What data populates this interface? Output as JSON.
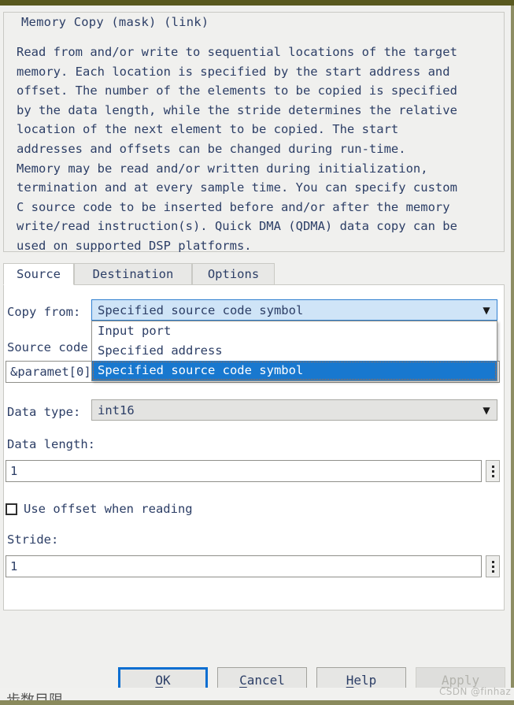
{
  "window": {
    "accent_border_color": "#59591f",
    "dialog_background": "#f0f0ee",
    "text_color": "#2c3e66"
  },
  "description_panel": {
    "title": "Memory Copy (mask) (link)",
    "body": "Read from and/or write to sequential locations of the target\nmemory. Each location is specified by the start address and\noffset. The number of the elements to be copied is specified\nby the data length, while the stride determines the relative\nlocation of the next element to be copied. The start\naddresses and offsets can be changed during run-time.\nMemory may be read and/or written during initialization,\ntermination and at every sample time. You can specify custom\nC source code to be inserted before and/or after the memory\nwrite/read instruction(s). Quick DMA (QDMA) data copy can be\nused on supported DSP platforms."
  },
  "tabs": [
    {
      "label": "Source",
      "active": true
    },
    {
      "label": "Destination",
      "active": false
    },
    {
      "label": "Options",
      "active": false
    }
  ],
  "form": {
    "copy_from": {
      "label": "Copy from:",
      "value": "Specified source code symbol",
      "expanded": true,
      "arrow_icon": "▼",
      "options": [
        "Input port",
        "Specified address",
        "Specified source code symbol"
      ],
      "selected_index": 2,
      "highlight_color": "#1878cf"
    },
    "source_code_symbol": {
      "label": "Source code",
      "value": "&paramet[0]"
    },
    "data_type": {
      "label": "Data type:",
      "value": "int16",
      "arrow_icon": "▼"
    },
    "data_length": {
      "label": "Data length:",
      "value": "1",
      "stepper_icon": "vertical-dots"
    },
    "use_offset": {
      "label": "Use offset when reading",
      "checked": false
    },
    "stride": {
      "label": "Stride:",
      "value": "1",
      "stepper_icon": "vertical-dots"
    }
  },
  "buttons": {
    "ok": {
      "label": "OK",
      "accel": "O",
      "default": true,
      "enabled": true,
      "focus_color": "#0a6ed1"
    },
    "cancel": {
      "label": "Cancel",
      "accel": "C",
      "enabled": true
    },
    "help": {
      "label": "Help",
      "accel": "H",
      "enabled": true
    },
    "apply": {
      "label": "Apply",
      "accel": "A",
      "enabled": false
    }
  },
  "watermark": {
    "text": "CSDN @finhaz"
  },
  "bottom_strip": {
    "text": "步数目限"
  }
}
